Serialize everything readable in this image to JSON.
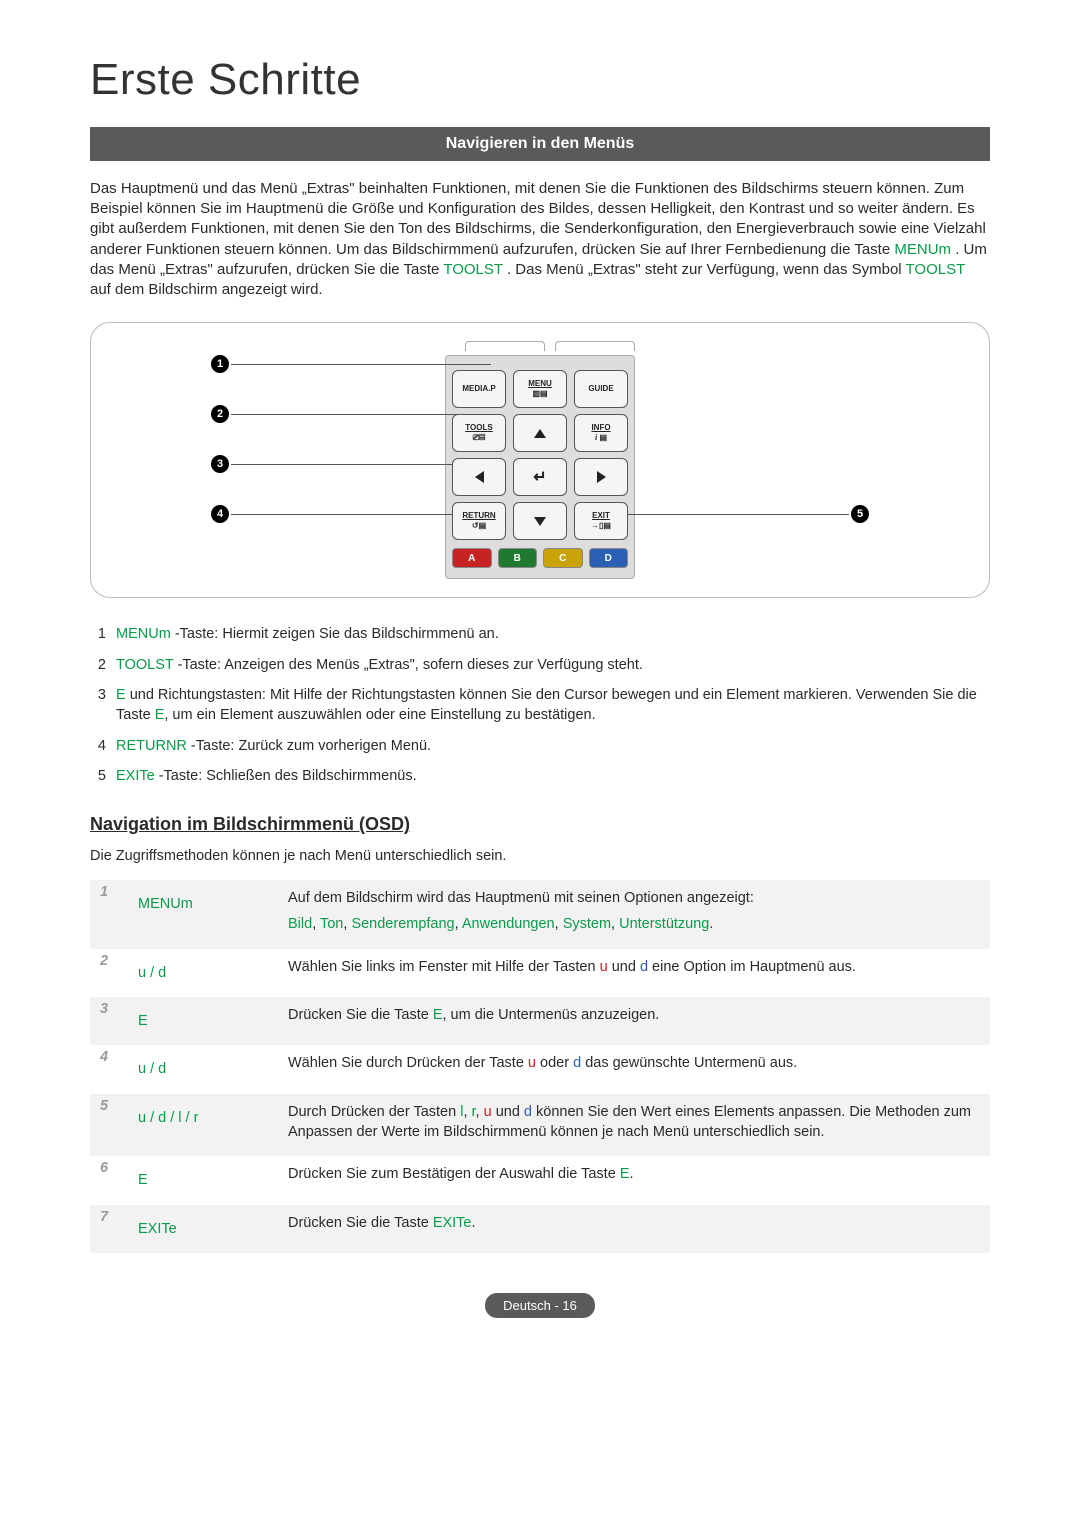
{
  "page_title": "Erste Schritte",
  "section_bar": "Navigieren in den Menüs",
  "intro": {
    "p1a": "Das Hauptmenü und das Menü „Extras\" beinhalten Funktionen, mit denen Sie die Funktionen des Bildschirms steuern können. Zum Beispiel können Sie im Hauptmenü die Größe und Konfiguration des Bildes, dessen Helligkeit, den Kontrast und so weiter ändern. Es gibt außerdem Funktionen, mit denen Sie den Ton des Bildschirms, die Senderkonfiguration, den Energieverbrauch sowie eine Vielzahl anderer Funktionen steuern können. Um das Bildschirmmenü aufzurufen, drücken Sie auf Ihrer Fernbedienung die Taste ",
    "menu_key": "MENUm",
    "p1b": ". Um das Menü „Extras\" aufzurufen, drücken Sie die Taste ",
    "tools_key": "TOOLST",
    "p1c": ". Das Menü „Extras\" steht zur Verfügung, wenn das Symbol ",
    "tools_key2": "TOOLST",
    "p1d": " auf dem Bildschirm angezeigt wird."
  },
  "remote": {
    "mediap": "MEDIA.P",
    "menu": "MENU",
    "guide": "GUIDE",
    "tools": "TOOLS",
    "info": "INFO",
    "return": "RETURN",
    "exit": "EXIT",
    "colorA": "A",
    "colorB": "B",
    "colorC": "C",
    "colorD": "D"
  },
  "callouts": {
    "c1": "1",
    "c2": "2",
    "c3": "3",
    "c4": "4",
    "c5": "5"
  },
  "legend": [
    {
      "num": "1",
      "key": "MENUm",
      "text": "-Taste: Hiermit zeigen Sie das Bildschirmmenü an."
    },
    {
      "num": "2",
      "key": "TOOLST",
      "text": "-Taste: Anzeigen des Menüs „Extras\", sofern dieses zur Verfügung steht."
    },
    {
      "num": "3",
      "key": "E",
      "text": " und Richtungstasten: Mit Hilfe der Richtungstasten können Sie den Cursor bewegen und ein Element markieren. Verwenden Sie die Taste ",
      "key2": "E",
      "text2": ", um ein Element auszuwählen oder eine Einstellung zu bestätigen."
    },
    {
      "num": "4",
      "key": "RETURNR",
      "text": "-Taste: Zurück zum vorherigen Menü."
    },
    {
      "num": "5",
      "key": "EXITe",
      "text": "-Taste: Schließen des Bildschirmmenüs."
    }
  ],
  "osd": {
    "heading": "Navigation im Bildschirmmenü (OSD)",
    "intro": "Die Zugriffsmethoden können je nach Menü unterschiedlich sein.",
    "steps": [
      {
        "num": "1",
        "key": "MENUm",
        "desc_a": "Auf dem Bildschirm wird das Hauptmenü mit seinen Optionen angezeigt:",
        "desc_links": [
          "Bild",
          "Ton",
          "Senderempfang",
          "Anwendungen",
          "System",
          "Unterstützung"
        ],
        "desc_suffix": "."
      },
      {
        "num": "2",
        "key": "u / d",
        "desc_a": "Wählen Sie links im Fenster mit Hilfe der Tasten ",
        "inline": [
          {
            "t": "u",
            "c": "red"
          },
          {
            "t": " und ",
            "c": ""
          },
          {
            "t": "d",
            "c": "blue"
          }
        ],
        "desc_b": " eine Option im Hauptmenü aus."
      },
      {
        "num": "3",
        "key": "E",
        "desc_a": "Drücken Sie die Taste ",
        "inline": [
          {
            "t": "E",
            "c": "green"
          }
        ],
        "desc_b": ", um die Untermenüs anzuzeigen."
      },
      {
        "num": "4",
        "key": "u / d",
        "desc_a": "Wählen Sie durch Drücken der Taste ",
        "inline": [
          {
            "t": "u",
            "c": "red"
          },
          {
            "t": " oder ",
            "c": ""
          },
          {
            "t": "d",
            "c": "blue"
          }
        ],
        "desc_b": " das gewünschte Untermenü aus."
      },
      {
        "num": "5",
        "key": "u / d / l / r",
        "desc_a": "Durch Drücken der Tasten ",
        "inline": [
          {
            "t": "l",
            "c": "green"
          },
          {
            "t": ", ",
            "c": ""
          },
          {
            "t": "r",
            "c": "green"
          },
          {
            "t": ", ",
            "c": ""
          },
          {
            "t": "u",
            "c": "red"
          },
          {
            "t": " und ",
            "c": ""
          },
          {
            "t": "d",
            "c": "blue"
          }
        ],
        "desc_b": " können Sie den Wert eines Elements anpassen. Die Methoden zum Anpassen der Werte im Bildschirmmenü können je nach Menü unterschiedlich sein."
      },
      {
        "num": "6",
        "key": "E",
        "desc_a": "Drücken Sie zum Bestätigen der Auswahl die Taste ",
        "inline": [
          {
            "t": "E",
            "c": "green"
          }
        ],
        "desc_b": "."
      },
      {
        "num": "7",
        "key": "EXITe",
        "desc_a": "Drücken Sie die Taste ",
        "inline": [
          {
            "t": "EXITe",
            "c": "green"
          }
        ],
        "desc_b": "."
      }
    ]
  },
  "footer": "Deutsch - 16"
}
